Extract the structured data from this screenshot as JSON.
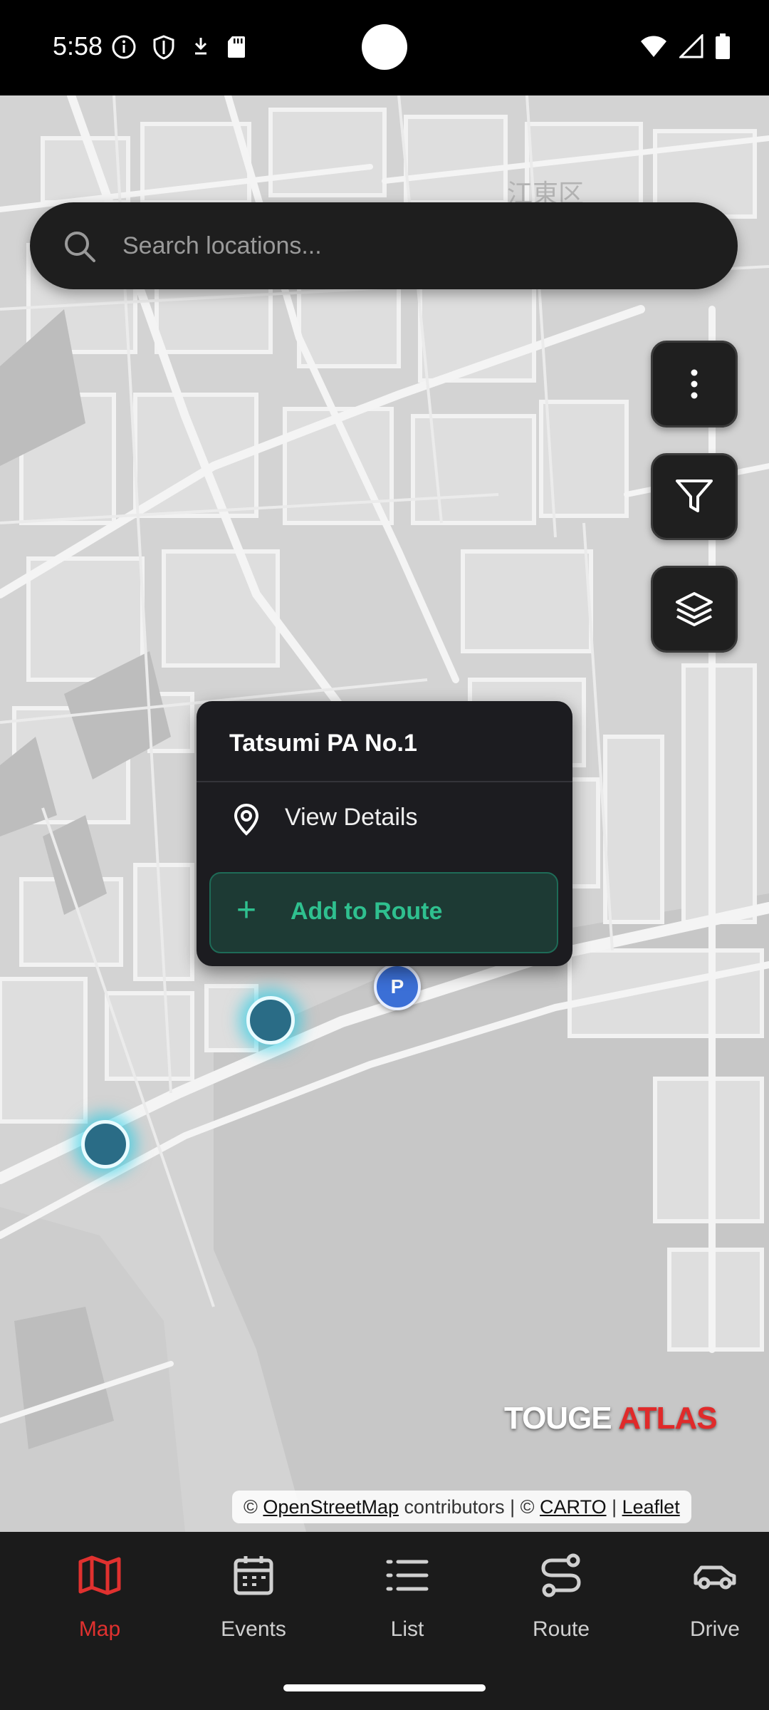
{
  "status_bar": {
    "time": "5:58",
    "left_icons": [
      "info-icon",
      "shield-icon",
      "download-icon",
      "sd-card-icon"
    ],
    "right_icons": [
      "wifi-icon",
      "signal-icon",
      "battery-icon"
    ]
  },
  "search": {
    "placeholder": "Search locations..."
  },
  "map_controls": {
    "buttons": [
      "more-options-icon",
      "filter-icon",
      "layers-icon"
    ]
  },
  "map_labels": {
    "district": "江東区"
  },
  "popup": {
    "title": "Tatsumi PA No.1",
    "view_details": "View Details",
    "add_to_route": "Add to Route",
    "accent_color": "#2fc08f"
  },
  "markers": {
    "parking_label": "P"
  },
  "brand": {
    "part1": "TOUGE",
    "part2": "ATLAS",
    "part2_color": "#e02a2a"
  },
  "attribution": {
    "prefix": "©",
    "osm": "OpenStreetMap",
    "contributors": "contributors | ©",
    "carto": "CARTO",
    "sep": "|",
    "leaflet": "Leaflet"
  },
  "nav": {
    "active_color": "#e0312f",
    "items": [
      {
        "label": "Map",
        "icon": "map-icon"
      },
      {
        "label": "Events",
        "icon": "calendar-icon"
      },
      {
        "label": "List",
        "icon": "list-icon"
      },
      {
        "label": "Route",
        "icon": "route-icon"
      },
      {
        "label": "Drive",
        "icon": "car-icon"
      }
    ]
  }
}
